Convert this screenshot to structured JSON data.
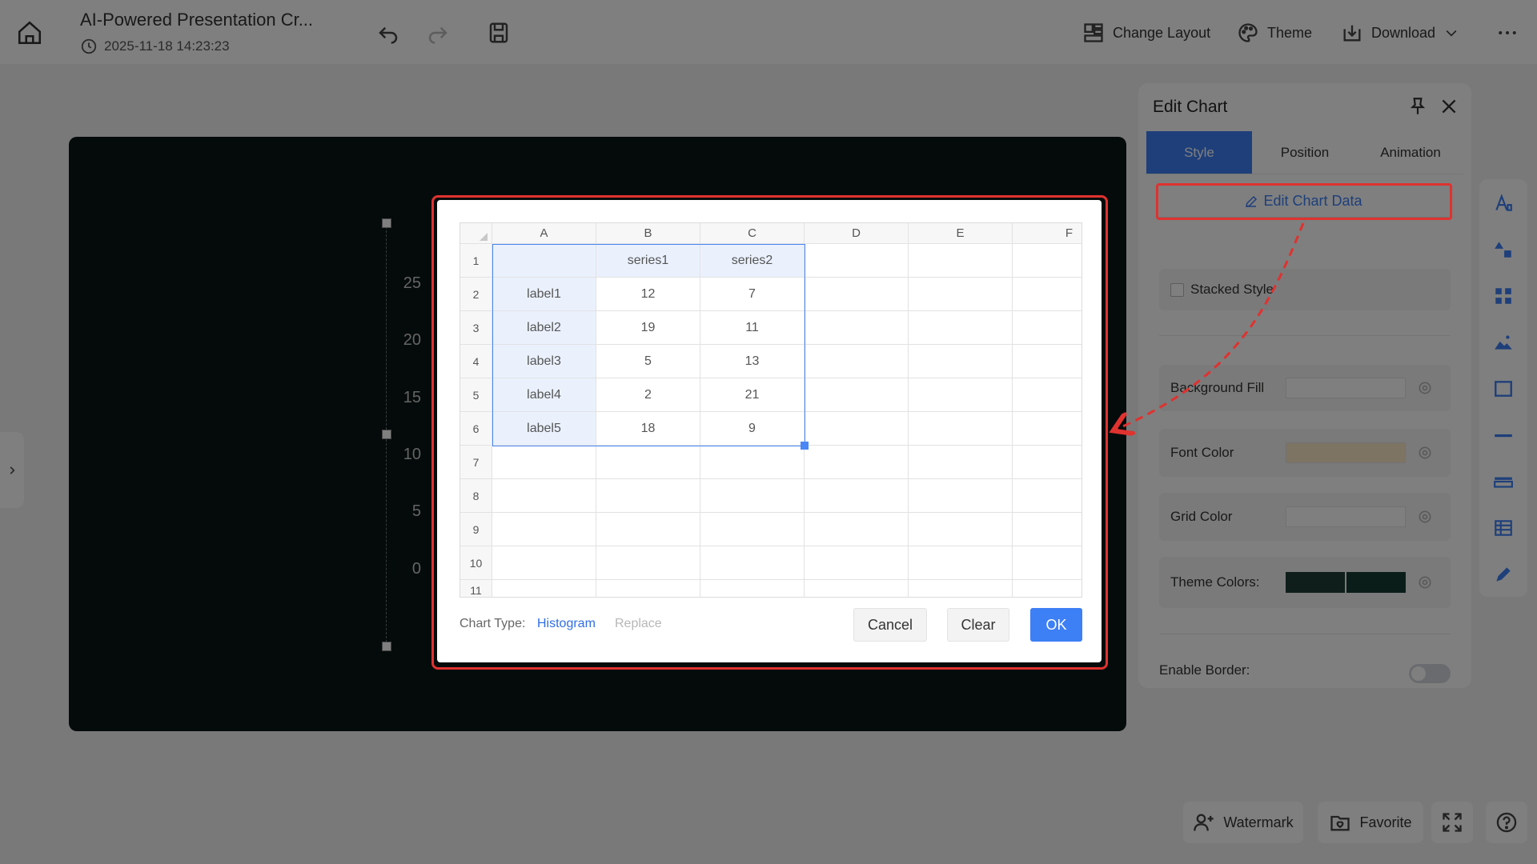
{
  "header": {
    "title": "AI-Powered Presentation Cr...",
    "timestamp": "2025-11-18 14:23:23",
    "change_layout": "Change Layout",
    "theme": "Theme",
    "download": "Download"
  },
  "slide": {
    "y_ticks": [
      "25",
      "20",
      "15",
      "10",
      "5",
      "0"
    ],
    "background": "#0a1716"
  },
  "panel": {
    "title": "Edit Chart",
    "tabs": [
      "Style",
      "Position",
      "Animation"
    ],
    "edit_chart_data": "Edit Chart Data",
    "stacked_style": "Stacked Style",
    "background_fill": "Background Fill",
    "font_color": "Font Color",
    "grid_color": "Grid Color",
    "theme_colors": "Theme Colors:",
    "theme_swatches": [
      "#1f3c34",
      "#163a33"
    ],
    "font_color_value": "#fde8c8",
    "enable_border": "Enable Border:"
  },
  "bottom": {
    "watermark": "Watermark",
    "favorite": "Favorite"
  },
  "modal": {
    "columns": [
      "A",
      "B",
      "C",
      "D",
      "E",
      "F"
    ],
    "rows": [
      "1",
      "2",
      "3",
      "4",
      "5",
      "6",
      "7",
      "8",
      "9",
      "10",
      "11"
    ],
    "cells": [
      [
        "",
        "series1",
        "series2"
      ],
      [
        "label1",
        "12",
        "7"
      ],
      [
        "label2",
        "19",
        "11"
      ],
      [
        "label3",
        "5",
        "13"
      ],
      [
        "label4",
        "2",
        "21"
      ],
      [
        "label5",
        "18",
        "9"
      ]
    ],
    "chart_type_label": "Chart Type:",
    "chart_type_value": "Histogram",
    "replace": "Replace",
    "cancel": "Cancel",
    "clear": "Clear",
    "ok": "OK"
  },
  "colors": {
    "accent": "#3d7ff5",
    "annotation": "#e0322f"
  }
}
